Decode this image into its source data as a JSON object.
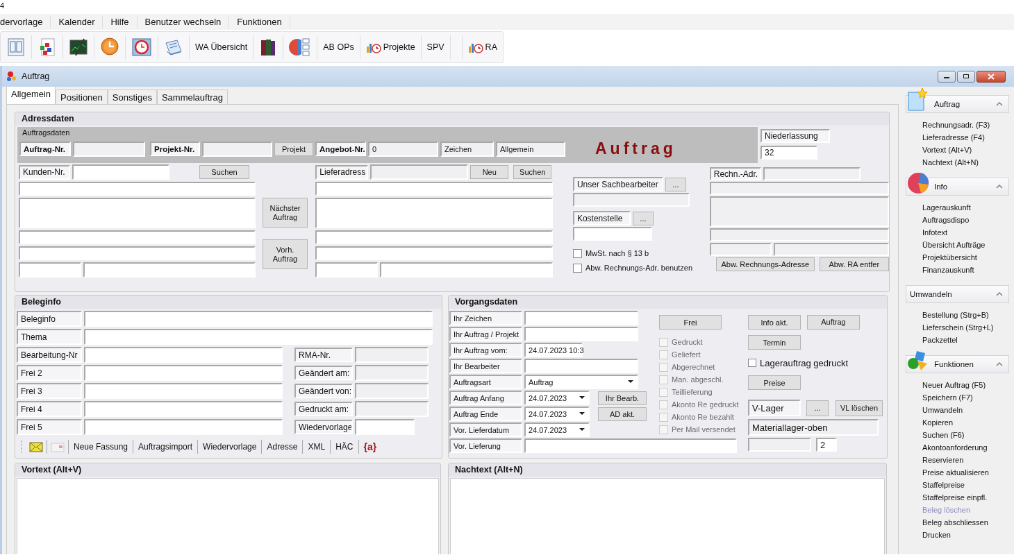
{
  "top_fragment": "4",
  "menu": [
    "dervorlage",
    "Kalender",
    "Hilfe",
    "Benutzer wechseln",
    "Funktionen"
  ],
  "toolbar": [
    {
      "kind": "icon"
    },
    {
      "kind": "icon"
    },
    {
      "kind": "icon"
    },
    {
      "kind": "icon"
    },
    {
      "kind": "icon"
    },
    {
      "kind": "icon"
    },
    {
      "kind": "text",
      "label": "WA Übersicht"
    },
    {
      "kind": "icon"
    },
    {
      "kind": "icon"
    },
    {
      "kind": "text",
      "label": "AB OPs"
    },
    {
      "kind": "icon_text",
      "label": "Projekte"
    },
    {
      "kind": "text",
      "label": "SPV"
    },
    {
      "kind": "icon"
    },
    {
      "kind": "icon_text",
      "label": "RA"
    }
  ],
  "window": {
    "title": "Auftrag"
  },
  "tabs": [
    {
      "label": "Allgemein",
      "selected": true
    },
    {
      "label": "Positionen",
      "selected": false
    },
    {
      "label": "Sonstiges",
      "selected": false
    },
    {
      "label": "Sammelauftrag",
      "selected": false
    }
  ],
  "adressdaten": {
    "title": "Adressdaten",
    "auftragsdaten": {
      "title": "Auftragsdaten",
      "auftrag_nr_label": "Auftrag-Nr.",
      "projekt_nr_label": "Projekt-Nr.",
      "projekt_button": "Projekt",
      "angebot_nr_label": "Angebot-Nr.",
      "angebot_nr": "0",
      "zeichen": "Zeichen",
      "allgemein": "Allgemein",
      "banner": "Auftrag"
    },
    "niederlassung_label": "Niederlassung",
    "niederlassung": "32",
    "kunden_nr_label": "Kunden-Nr.",
    "kunden_suchen": "Suchen",
    "next_button": "Nächster Auftrag",
    "prev_button": "Vorh. Auftrag",
    "lieferadress_label": "Lieferadress",
    "liefer_neu": "Neu",
    "liefer_suchen": "Suchen",
    "sachbearbeiter_label": "Unser Sachbearbeiter",
    "sachbearbeiter_button": "...",
    "kostenstelle_label": "Kostenstelle",
    "kostenstelle_button": "...",
    "checkboxes": [
      {
        "label": "MwSt. nach § 13 b",
        "checked": false
      },
      {
        "label": "Abw. Rechnungs-Adr. benutzen",
        "checked": false
      }
    ],
    "rechn_adr_label": "Rechn.-Adr.",
    "abw_button": "Abw. Rechnungs-Adresse",
    "abw_remove_button": "Abw. RA entfer"
  },
  "beleginfo": {
    "title": "Beleginfo",
    "wide_rows": [
      "Beleginfo",
      "Thema"
    ],
    "left_rows": [
      "Bearbeitung-Nr",
      "Frei 2",
      "Frei 3",
      "Frei 4",
      "Frei 5"
    ],
    "right_rows": [
      {
        "label": "RMA-Nr.",
        "disabled": true
      },
      {
        "label": "Geändert am:",
        "disabled": true
      },
      {
        "label": "Geändert von:",
        "disabled": true
      },
      {
        "label": "Gedruckt am:",
        "disabled": true
      },
      {
        "label": "Wiedervorlage",
        "disabled": false
      }
    ],
    "tools": [
      {
        "kind": "icon"
      },
      {
        "kind": "icon"
      },
      {
        "kind": "text",
        "label": "Neue Fassung"
      },
      {
        "kind": "text",
        "label": "Auftragsimport"
      },
      {
        "kind": "text",
        "label": "Wiedervorlage"
      },
      {
        "kind": "text",
        "label": "Adresse"
      },
      {
        "kind": "text",
        "label": "XML"
      },
      {
        "kind": "text",
        "label": "HÄC"
      },
      {
        "kind": "glyph",
        "label": "{a}"
      }
    ]
  },
  "vorgangsdaten": {
    "title": "Vorgangsdaten",
    "rows": [
      {
        "label": "Ihr Zeichen",
        "kind": "text"
      },
      {
        "label": "Ihr Auftrag / Projekt",
        "kind": "text"
      },
      {
        "label": "Ihr Auftrag vom:",
        "kind": "short",
        "value": "24.07.2023 10:3"
      },
      {
        "label": "Ihr Bearbeiter",
        "kind": "text"
      },
      {
        "label": "Auftragsart",
        "kind": "select",
        "value": "Auftrag"
      },
      {
        "label": "Auftrag Anfang",
        "kind": "date",
        "value": "24.07.2023",
        "button": "Ihr Bearb."
      },
      {
        "label": "Auftrag Ende",
        "kind": "date",
        "value": "24.07.2023",
        "button": "AD akt."
      },
      {
        "label": "Vor. Lieferdatum",
        "kind": "date",
        "value": "24.07.2023"
      },
      {
        "label": "Vor. Lieferung",
        "kind": "wide"
      }
    ],
    "frei_button": "Frei",
    "status": [
      {
        "label": "Gedruckt",
        "checked": false,
        "disabled": true
      },
      {
        "label": "Geliefert",
        "checked": false,
        "disabled": true
      },
      {
        "label": "Abgerechnet",
        "checked": false,
        "disabled": true
      },
      {
        "label": "Man. abgeschl.",
        "checked": false,
        "disabled": true
      },
      {
        "label": "Teillieferung",
        "checked": false,
        "disabled": true
      },
      {
        "label": "Akonto Re gedruckt",
        "checked": false,
        "disabled": true
      },
      {
        "label": "Akonto Re bezahlt",
        "checked": false,
        "disabled": true
      },
      {
        "label": "Per Mail versendet",
        "checked": false,
        "disabled": true
      }
    ],
    "info_button": "Info akt.",
    "auftrag_button": "Auftrag",
    "termin_button": "Termin",
    "lager_check": {
      "label": "Lagerauftrag gedruckt",
      "checked": false
    },
    "preise_button": "Preise",
    "vlager_label": "V-Lager",
    "vlager_button": "...",
    "vl_loeschen": "VL löschen",
    "lager": "Materiallager-oben",
    "count": "2"
  },
  "vortext": {
    "title": "Vortext (Alt+V)"
  },
  "nachtext": {
    "title": "Nachtext (Alt+N)"
  },
  "sidebar": [
    {
      "title": "Auftrag",
      "kind": "document",
      "expanded": true,
      "items": [
        {
          "label": "Rechnungsadr. (F3)",
          "disabled": false
        },
        {
          "label": "Lieferadresse (F4)",
          "disabled": false
        },
        {
          "label": "Vortext (Alt+V)",
          "disabled": false
        },
        {
          "label": "Nachtext (Alt+N)",
          "disabled": false
        }
      ]
    },
    {
      "title": "Info",
      "kind": "pie",
      "expanded": true,
      "items": [
        {
          "label": "Lagerauskunft",
          "disabled": false
        },
        {
          "label": "Auftragsdispo",
          "disabled": false
        },
        {
          "label": "Infotext",
          "disabled": false
        },
        {
          "label": "Übersicht Aufträge",
          "disabled": false
        },
        {
          "label": "Projektübersicht",
          "disabled": false
        },
        {
          "label": "Finanzauskunft",
          "disabled": false
        }
      ]
    },
    {
      "title": "Umwandeln",
      "kind": "plain",
      "expanded": true,
      "items": [
        {
          "label": "Bestellung (Strg+B)",
          "disabled": false
        },
        {
          "label": "Lieferschein (Strg+L)",
          "disabled": false
        },
        {
          "label": "Packzettel",
          "disabled": false
        }
      ]
    },
    {
      "title": "Funktionen",
      "kind": "shapes",
      "expanded": true,
      "items": [
        {
          "label": "Neuer Auftrag (F5)",
          "disabled": false
        },
        {
          "label": "Speichern (F7)",
          "disabled": false
        },
        {
          "label": "Umwandeln",
          "disabled": false
        },
        {
          "label": "Kopieren",
          "disabled": false
        },
        {
          "label": "Suchen (F6)",
          "disabled": false
        },
        {
          "label": "Akontoanforderung",
          "disabled": false
        },
        {
          "label": "Reservieren",
          "disabled": false
        },
        {
          "label": "Preise aktualisieren",
          "disabled": false
        },
        {
          "label": "Staffelpreise",
          "disabled": false
        },
        {
          "label": "Staffelpreise einpfl.",
          "disabled": false
        },
        {
          "label": "Beleg löschen",
          "disabled": true
        },
        {
          "label": "Beleg abschliessen",
          "disabled": false
        },
        {
          "label": "Drucken",
          "disabled": false
        }
      ]
    }
  ]
}
